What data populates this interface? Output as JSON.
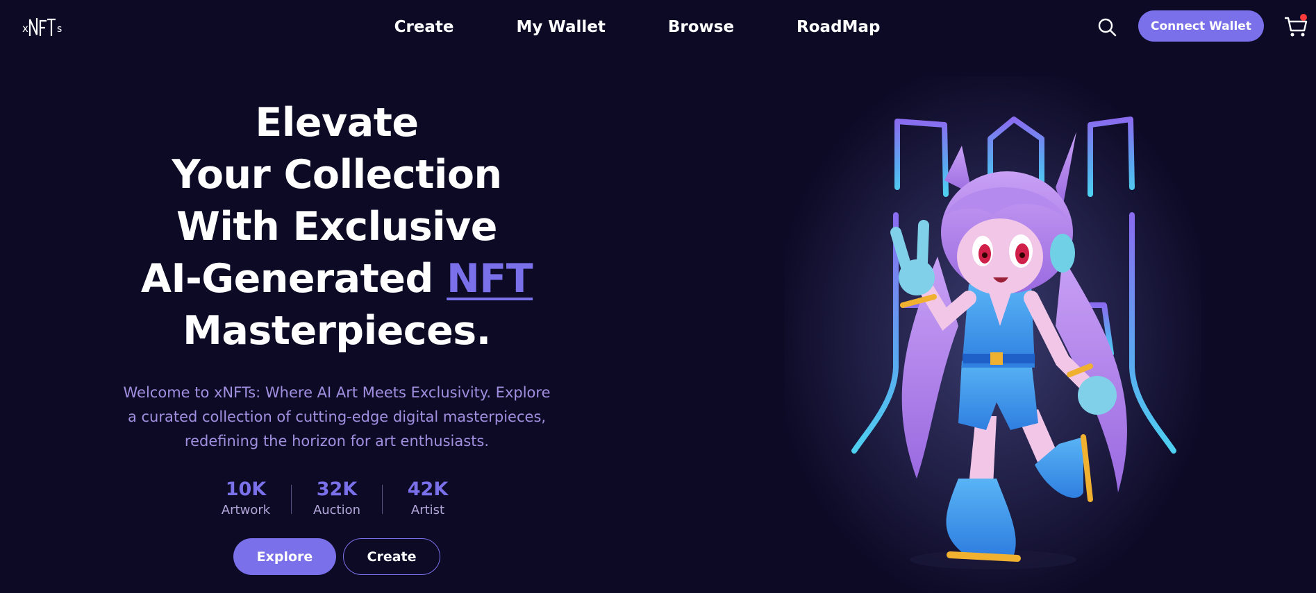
{
  "header": {
    "logo_text": "xNFTs",
    "nav": [
      "Create",
      "My Wallet",
      "Browse",
      "RoadMap"
    ],
    "connect_label": "Connect Wallet",
    "search_icon": "search-icon",
    "cart_icon": "cart-icon",
    "cart_badge_color": "#ff3b3b"
  },
  "hero": {
    "title_lines": [
      "Elevate",
      "Your Collection",
      "With Exclusive",
      "AI-Generated ",
      "Masterpieces."
    ],
    "title_accent": "NFT",
    "description": "Welcome to xNFTs: Where AI Art Meets Exclusivity. Explore a curated collection of cutting-edge digital masterpieces, redefining the horizon for art enthusiasts.",
    "stats": [
      {
        "value": "10K",
        "label": "Artwork"
      },
      {
        "value": "32K",
        "label": "Auction"
      },
      {
        "value": "42K",
        "label": "Artist"
      }
    ],
    "explore_label": "Explore",
    "create_label": "Create"
  },
  "colors": {
    "background": "#0d0a26",
    "accent": "#7a70ea",
    "description": "#a18fe0"
  }
}
